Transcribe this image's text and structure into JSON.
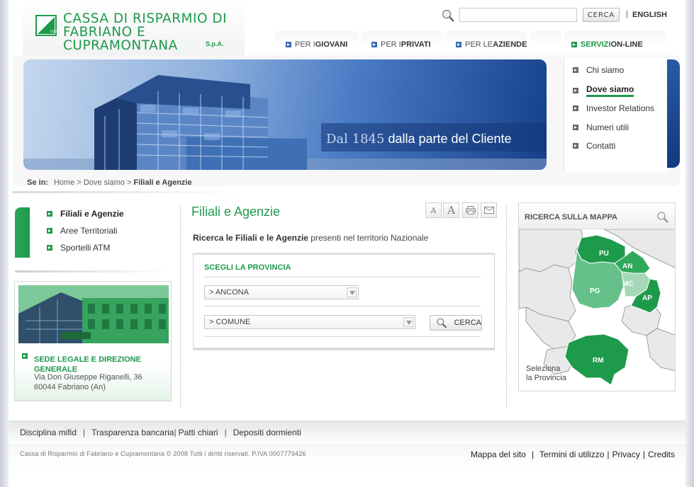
{
  "header": {
    "logo_line1": "CASSA DI RISPARMIO DI",
    "logo_line2": "FABRIANO E CUPRAMONTANA",
    "logo_spa": "S.p.A.",
    "search_button": "CERCA",
    "lang_separator": "|",
    "lang_link": "ENGLISH"
  },
  "tabs": [
    {
      "prefix": "PER I ",
      "label": "GIOVANI"
    },
    {
      "prefix": "PER I ",
      "label": "PRIVATI"
    },
    {
      "prefix": "PER LE ",
      "label": "AZIENDE"
    },
    {
      "prefix": "SERVIZI ",
      "label": "ON-LINE"
    }
  ],
  "banner": {
    "since": "Dal 1845",
    "tagline": " dalla parte del Cliente"
  },
  "right_menu": [
    {
      "label": "Chi siamo",
      "active": false
    },
    {
      "label": "Dove siamo",
      "active": true
    },
    {
      "label": "Investor Relations",
      "active": false
    },
    {
      "label": "Numeri utili",
      "active": false
    },
    {
      "label": "Contatti",
      "active": false
    }
  ],
  "breadcrumb": {
    "label": "Se in:",
    "home": "Home",
    "sep": " > ",
    "section": "Dove siamo",
    "current": "Filiali e Agenzie"
  },
  "left_nav": [
    {
      "label": "Filiali e Agenzie",
      "active": true
    },
    {
      "label": "Aree Territoriali",
      "active": false
    },
    {
      "label": "Sportelli ATM",
      "active": false
    }
  ],
  "headquarters": {
    "title": "SEDE LEGALE E DIREZIONE GENERALE",
    "address_line1": "Via Don Giuseppe Riganelli, 36",
    "address_line2": "60044 Fabriano (An)"
  },
  "main": {
    "title": "Filiali e Agenzie",
    "intro_bold": "Ricerca le Filiali e le Agenzie",
    "intro_rest": " presenti nel territorio Nazionale",
    "form_heading": "SCEGLI LA PROVINCIA",
    "province_select": "> ANCONA",
    "comune_select": "> COMUNE",
    "search_button": "CERCA"
  },
  "map": {
    "title": "RICERCA SULLA MAPPA",
    "provinces": [
      "PU",
      "AN",
      "MC",
      "PG",
      "AP",
      "RM"
    ],
    "hint_line1": "Seleziona",
    "hint_line2": "la Provincia"
  },
  "footer": {
    "links": [
      "Disciplina mifid",
      "Trasparenza bancaria",
      "Patti chiari",
      "Depositi dormienti"
    ],
    "copyright": "Cassa di Risparmio di Fabriano e Cupramontana © 2008 Tutti i diritti riservati. P.IVA 0007779426",
    "right_links": [
      "Mappa del sito",
      "Termini di utilizzo",
      "Privacy",
      "Credits"
    ]
  },
  "colors": {
    "brand_green": "#1d9a4a",
    "banner_blue": "#16408a"
  }
}
